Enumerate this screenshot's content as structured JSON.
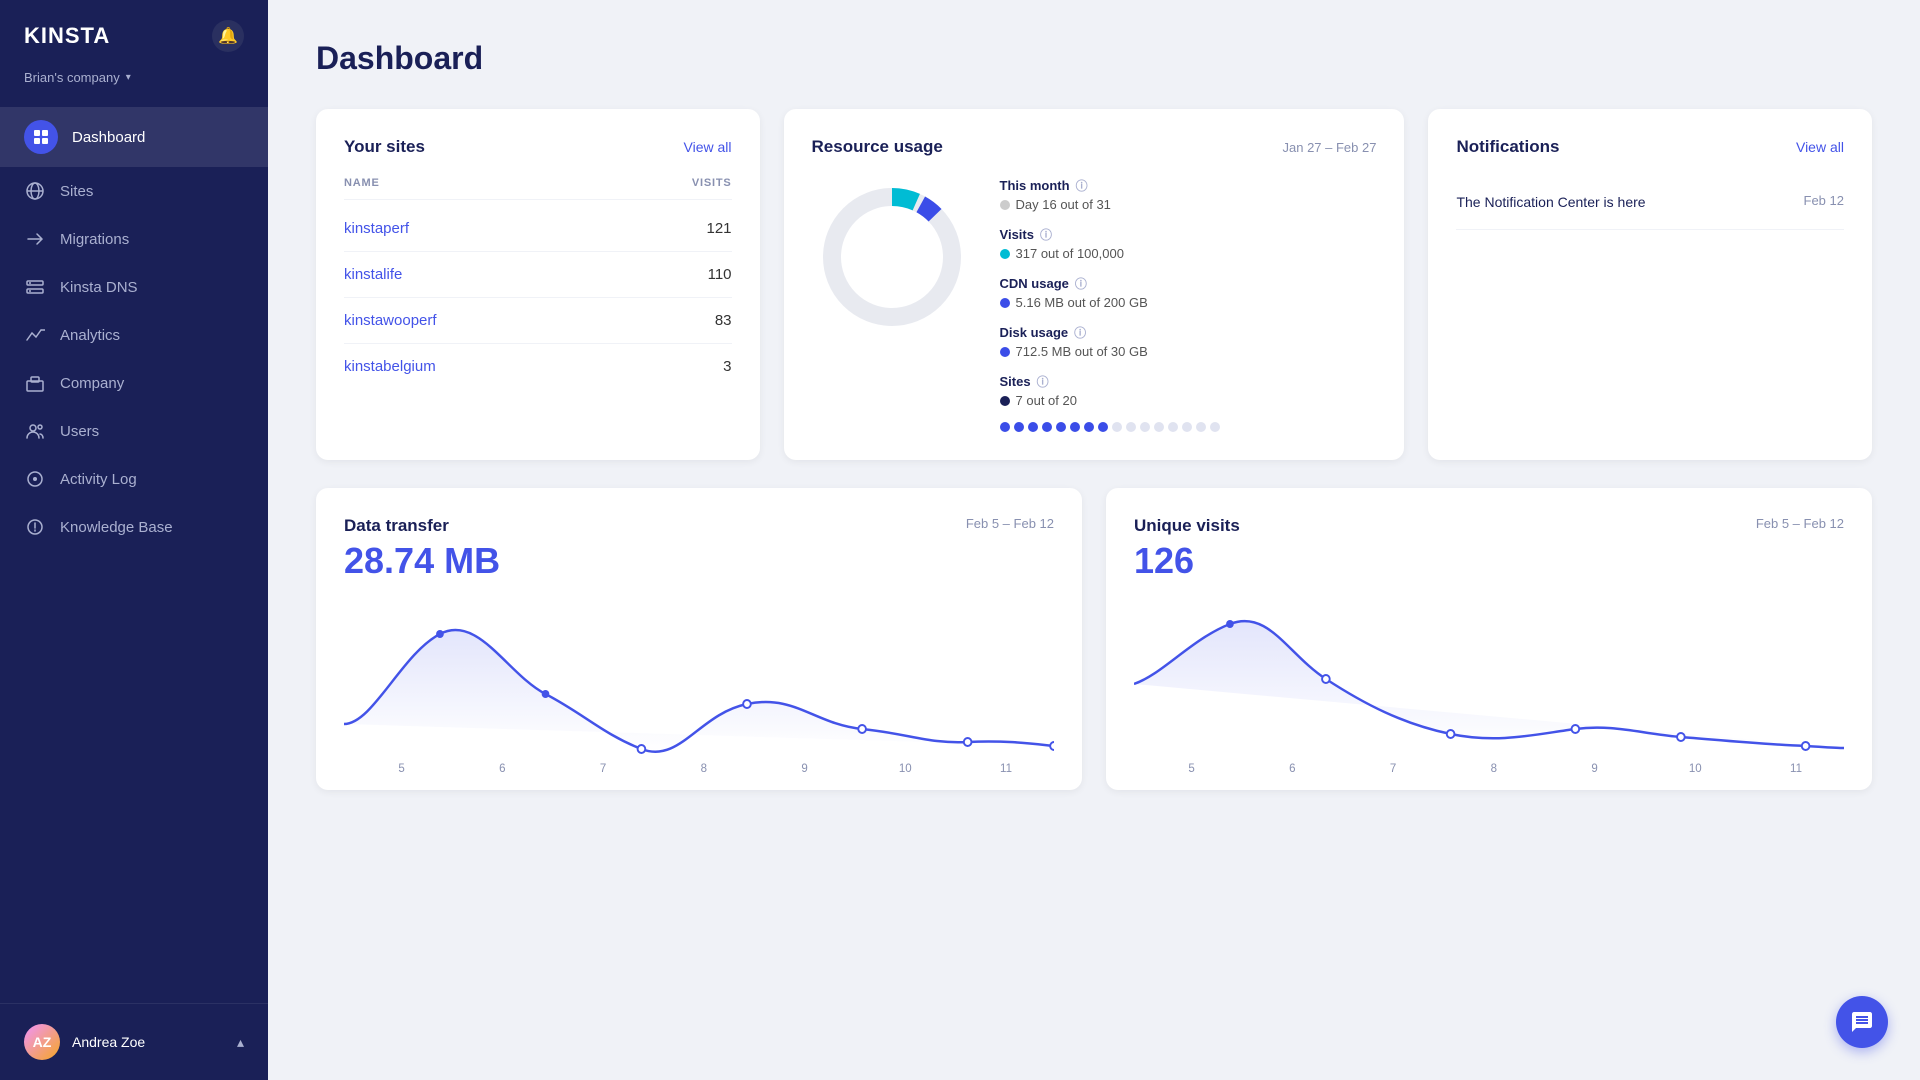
{
  "app": {
    "logo": "KINSTA",
    "company": "Brian's company",
    "page_title": "Dashboard"
  },
  "sidebar": {
    "items": [
      {
        "id": "dashboard",
        "label": "Dashboard",
        "icon": "⊞",
        "active": true
      },
      {
        "id": "sites",
        "label": "Sites",
        "icon": "◎",
        "active": false
      },
      {
        "id": "migrations",
        "label": "Migrations",
        "icon": "⇄",
        "active": false
      },
      {
        "id": "kinsta-dns",
        "label": "Kinsta DNS",
        "icon": "⊡",
        "active": false
      },
      {
        "id": "analytics",
        "label": "Analytics",
        "icon": "↗",
        "active": false
      },
      {
        "id": "company",
        "label": "Company",
        "icon": "▦",
        "active": false
      },
      {
        "id": "users",
        "label": "Users",
        "icon": "⊕",
        "active": false
      },
      {
        "id": "activity-log",
        "label": "Activity Log",
        "icon": "◉",
        "active": false
      },
      {
        "id": "knowledge-base",
        "label": "Knowledge Base",
        "icon": "◈",
        "active": false
      }
    ],
    "user": {
      "name": "Andrea Zoe",
      "initials": "AZ"
    }
  },
  "your_sites": {
    "title": "Your sites",
    "view_all": "View all",
    "columns": {
      "name": "NAME",
      "visits": "VISITS"
    },
    "sites": [
      {
        "name": "kinstaperf",
        "visits": "121"
      },
      {
        "name": "kinstalife",
        "visits": "110"
      },
      {
        "name": "kinstawooperf",
        "visits": "83"
      },
      {
        "name": "kinstabelgium",
        "visits": "3"
      }
    ]
  },
  "resource_usage": {
    "title": "Resource usage",
    "date_range": "Jan 27 – Feb 27",
    "this_month_label": "This month",
    "this_month_value": "Day 16 out of 31",
    "visits_label": "Visits",
    "visits_value": "317 out of 100,000",
    "cdn_label": "CDN usage",
    "cdn_value": "5.16 MB out of 200 GB",
    "disk_label": "Disk usage",
    "disk_value": "712.5 MB out of 30 GB",
    "sites_label": "Sites",
    "sites_value": "7 out of 20",
    "sites_used": 7,
    "sites_total": 20,
    "progress_dots_filled": 8,
    "progress_dots_total": 16
  },
  "notifications": {
    "title": "Notifications",
    "view_all": "View all",
    "items": [
      {
        "text": "The Notification Center is here",
        "date": "Feb 12"
      }
    ]
  },
  "data_transfer": {
    "title": "Data transfer",
    "date_range": "Feb 5 – Feb 12",
    "value": "28.74 MB",
    "x_labels": [
      "5",
      "6",
      "7",
      "8",
      "9",
      "10",
      "11"
    ]
  },
  "unique_visits": {
    "title": "Unique visits",
    "date_range": "Feb 5 – Feb 12",
    "value": "126",
    "x_labels": [
      "5",
      "6",
      "7",
      "8",
      "9",
      "10",
      "11"
    ]
  },
  "colors": {
    "accent": "#4353e8",
    "teal": "#00bcd4",
    "dark_navy": "#1a2057"
  }
}
